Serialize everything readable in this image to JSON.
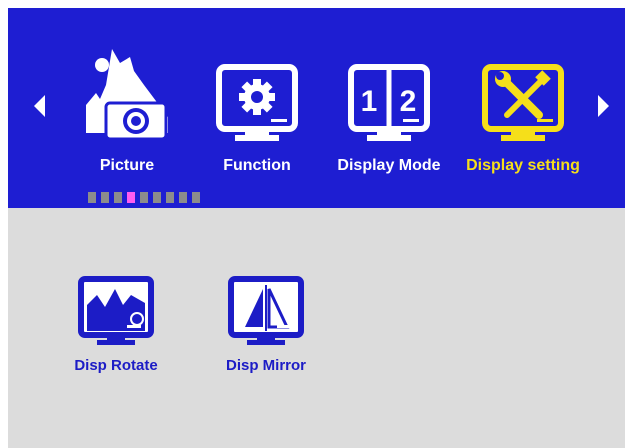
{
  "nav": {
    "prev_icon": "triangle-left-icon",
    "next_icon": "triangle-right-icon"
  },
  "menu": [
    {
      "label": "Picture",
      "icon": "picture-icon",
      "active": false
    },
    {
      "label": "Function",
      "icon": "gear-monitor-icon",
      "active": false
    },
    {
      "label": "Display Mode",
      "icon": "split-screen-icon",
      "active": false
    },
    {
      "label": "Display setting",
      "icon": "tools-monitor-icon",
      "active": true
    }
  ],
  "pager": {
    "total": 9,
    "current_index": 3
  },
  "submenu": [
    {
      "label": "Disp Rotate",
      "icon": "rotate-monitor-icon"
    },
    {
      "label": "Disp Mirror",
      "icon": "mirror-monitor-icon"
    }
  ],
  "colors": {
    "top_background": "#1e1ed2",
    "content_background": "#dcdcdc",
    "active_accent": "#f5df1a",
    "pager_current": "#ff5cf0",
    "pager_default": "#8c8c8c",
    "submenu_text": "#1c1cc6"
  }
}
